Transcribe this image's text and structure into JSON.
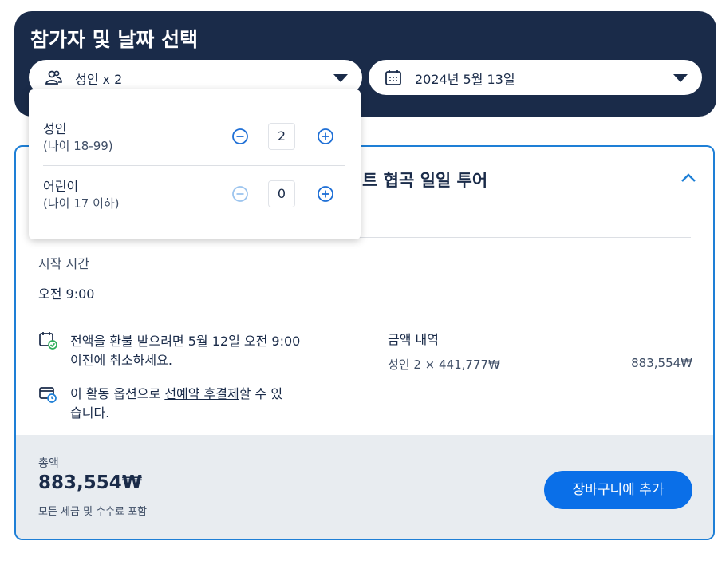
{
  "header": {
    "title": "참가자 및 날짜 선택",
    "participants_label": "성인 x 2",
    "date_label": "2024년 5월 13일"
  },
  "popover": {
    "adult": {
      "label": "성인",
      "age": "(나이 18-99)",
      "count": "2"
    },
    "child": {
      "label": "어린이",
      "age": "(나이 17 이하)",
      "count": "0"
    }
  },
  "card": {
    "title_visible": "트 협곡 일일 투어",
    "start_time_label": "시작 시간",
    "start_time_value": "오전 9:00",
    "refund_line1": "전액을 환불 받으려면 5월 12일 오전 9:00",
    "refund_line2": "이전에 취소하세요.",
    "reserve_line1_pre": "이 활동 옵션으로 ",
    "reserve_link": "선예약 후결제",
    "reserve_line1_post": "할 수 있",
    "reserve_line2": "습니다.",
    "price_breakdown_title": "금액 내역",
    "price_line_label": "성인 2 × 441,777₩",
    "price_line_value": "883,554₩"
  },
  "footer": {
    "total_label": "총액",
    "total_value": "883,554₩",
    "tax_note": "모든 세금 및 수수료 포함",
    "cart_button": "장바구니에 추가"
  },
  "colors": {
    "navy": "#1a2b49",
    "accent_blue": "#0a6fe8",
    "card_border": "#1e7fd6",
    "footer_bg": "#e8ecf0"
  }
}
